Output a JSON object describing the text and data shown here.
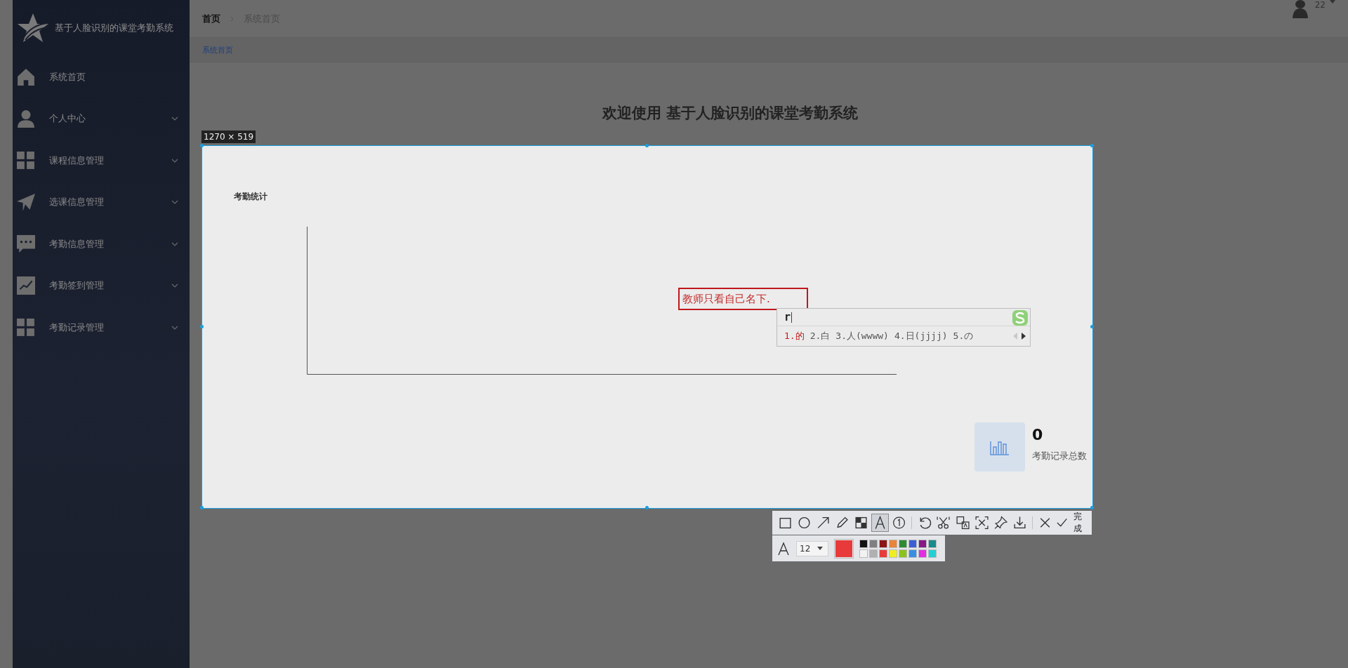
{
  "sidebar": {
    "title": "基于人脸识别的课堂考勤系统",
    "items": [
      {
        "label": "系统首页",
        "expandable": false
      },
      {
        "label": "个人中心",
        "expandable": true
      },
      {
        "label": "课程信息管理",
        "expandable": true
      },
      {
        "label": "选课信息管理",
        "expandable": true
      },
      {
        "label": "考勤信息管理",
        "expandable": true
      },
      {
        "label": "考勤签到管理",
        "expandable": true
      },
      {
        "label": "考勤记录管理",
        "expandable": true
      }
    ]
  },
  "header": {
    "breadcrumb": [
      "首页",
      "系统首页"
    ],
    "user": "22",
    "tabs": [
      {
        "label": "系统首页",
        "selected": true
      }
    ]
  },
  "page": {
    "heading": "欢迎使用 基于人脸识别的课堂考勤系统"
  },
  "selection": {
    "size": "1270 × 519",
    "panel_title": "考勤统计",
    "annotation": "教师只看自己名下.",
    "stat": {
      "value": "0",
      "label": "考勤记录总数"
    }
  },
  "ime": {
    "input": "r",
    "candidates": [
      {
        "label": "1.的",
        "selected": true
      },
      {
        "label": "2.白",
        "selected": false
      },
      {
        "label": "3.人(wwww)",
        "selected": false
      },
      {
        "label": "4.日(jjjj)",
        "selected": false
      },
      {
        "label": "5.の",
        "selected": false
      }
    ]
  },
  "toolbar": {
    "tools": [
      {
        "selected": false
      },
      {
        "selected": false
      },
      {
        "selected": false
      },
      {
        "selected": false
      },
      {
        "selected": false
      },
      {
        "selected": true
      },
      {
        "selected": false
      },
      {
        "selected": false
      },
      {
        "selected": false
      },
      {
        "selected": false
      },
      {
        "selected": false
      },
      {
        "selected": false
      },
      {
        "selected": false
      },
      {
        "selected": false
      }
    ],
    "done": "完成"
  },
  "text_style": {
    "font_size": "12",
    "palette": [
      {
        "color": "#121212"
      },
      {
        "color": "#808080"
      },
      {
        "color": "#8c1515"
      },
      {
        "color": "#e8853a"
      },
      {
        "color": "#2e8b34"
      },
      {
        "color": "#3b5fd4"
      },
      {
        "color": "#861a88"
      },
      {
        "color": "#1b8a8c"
      },
      {
        "color": "#f2f2f2"
      },
      {
        "color": "#b0b0b0"
      },
      {
        "color": "#e83a3a"
      },
      {
        "color": "#eeee22"
      },
      {
        "color": "#8cc21e"
      },
      {
        "color": "#3a8ee2"
      },
      {
        "color": "#e22ee2"
      },
      {
        "color": "#22d0d4"
      }
    ]
  }
}
